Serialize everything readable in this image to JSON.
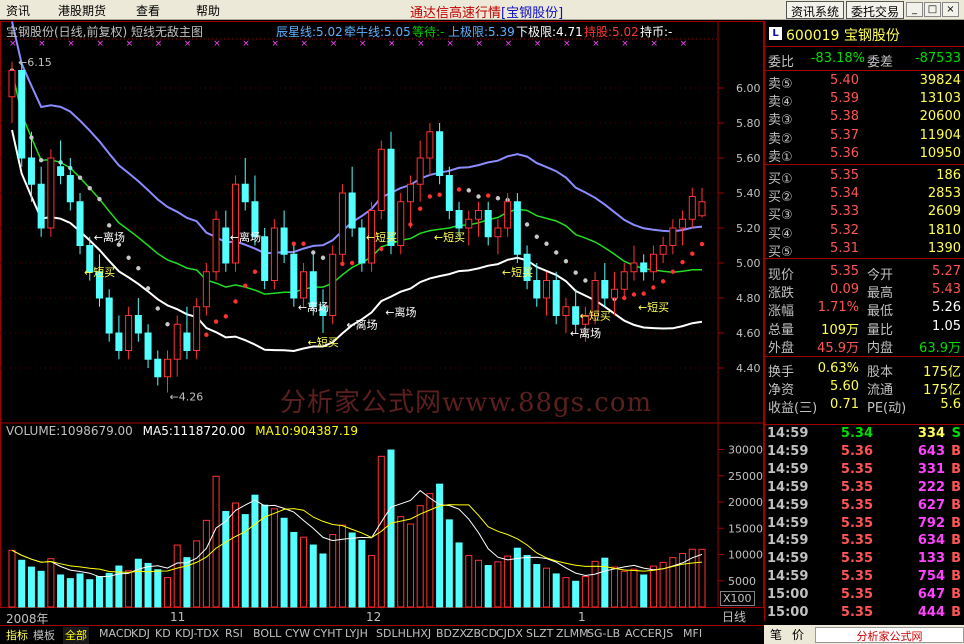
{
  "menu": [
    {
      "label": "资讯"
    },
    {
      "label": "港股期货"
    },
    {
      "label": "查看"
    },
    {
      "label": "帮助"
    }
  ],
  "app_title": "通达信高速行情",
  "app_stock": "[宝钢股份]",
  "toolbar": {
    "info_sys": "资讯系统",
    "trade": "委托交易"
  },
  "window_buttons": {
    "minimize": "_",
    "maximize": "□",
    "close": "×"
  },
  "chart_header": {
    "title": "宝钢股份(日线,前复权) 短线无敌主图",
    "items": [
      {
        "text": "辰星线:5.02",
        "color": "#5fafff"
      },
      {
        "text": "牵牛线:5.05",
        "color": "#5fafff"
      },
      {
        "text": "等待:-",
        "color": "#00cc00"
      },
      {
        "text": "上极限:5.39",
        "color": "#5fafff"
      },
      {
        "text": "下极限:4.71",
        "color": "#ffffff"
      },
      {
        "text": "持股:5.02",
        "color": "#ff3333"
      },
      {
        "text": "持币:-",
        "color": "#ffffff"
      }
    ]
  },
  "price_axis": [
    "6.00",
    "5.80",
    "5.60",
    "5.40",
    "5.20",
    "5.00",
    "4.80",
    "4.60",
    "4.40"
  ],
  "price_labels": {
    "high": "6.15",
    "low": "4.26"
  },
  "annotations": [
    "离场",
    "短买",
    "离场",
    "离场",
    "短买",
    "离场",
    "短买",
    "离场",
    "短买",
    "短买",
    "离场",
    "短买",
    "短买"
  ],
  "volume_header": {
    "volume": "VOLUME:1098679.00",
    "ma5": "MA5:1118720.00",
    "ma10": "MA10:904387.19"
  },
  "volume_axis": [
    "30000",
    "25000",
    "20000",
    "15000",
    "10000",
    "5000"
  ],
  "volume_unit": "X100",
  "x_axis": [
    "2008年",
    "11",
    "12",
    "1"
  ],
  "period_label": "日线",
  "watermark": "分析家公式网www.88gs.com",
  "quote": {
    "code": "600019",
    "name": "宝钢股份",
    "badge": "L",
    "weibi_label": "委比",
    "weibi": "-83.18%",
    "weicha_label": "委差",
    "weicha": "-87533",
    "asks": [
      {
        "label": "卖⑤",
        "price": "5.40",
        "vol": "39824"
      },
      {
        "label": "卖④",
        "price": "5.39",
        "vol": "13103"
      },
      {
        "label": "卖③",
        "price": "5.38",
        "vol": "20600"
      },
      {
        "label": "卖②",
        "price": "5.37",
        "vol": "11904"
      },
      {
        "label": "卖①",
        "price": "5.36",
        "vol": "10950"
      }
    ],
    "bids": [
      {
        "label": "买①",
        "price": "5.35",
        "vol": "186"
      },
      {
        "label": "买②",
        "price": "5.34",
        "vol": "2853"
      },
      {
        "label": "买③",
        "price": "5.33",
        "vol": "2609"
      },
      {
        "label": "买④",
        "price": "5.32",
        "vol": "1810"
      },
      {
        "label": "买⑤",
        "price": "5.31",
        "vol": "1390"
      }
    ],
    "stats": [
      {
        "l1": "现价",
        "v1": "5.35",
        "c1": "#ff5555",
        "l2": "今开",
        "v2": "5.27",
        "c2": "#ff5555"
      },
      {
        "l1": "涨跌",
        "v1": "0.09",
        "c1": "#ff5555",
        "l2": "最高",
        "v2": "5.43",
        "c2": "#ff5555"
      },
      {
        "l1": "涨幅",
        "v1": "1.71%",
        "c1": "#ff5555",
        "l2": "最低",
        "v2": "5.26",
        "c2": "#ffffff"
      },
      {
        "l1": "总量",
        "v1": "109万",
        "c1": "#ffff54",
        "l2": "量比",
        "v2": "1.05",
        "c2": "#ffffff"
      },
      {
        "l1": "外盘",
        "v1": "45.9万",
        "c1": "#ff5555",
        "l2": "内盘",
        "v2": "63.9万",
        "c2": "#00dd00"
      }
    ],
    "stats2": [
      {
        "l1": "换手",
        "v1": "0.63%",
        "l2": "股本",
        "v2": "175亿"
      },
      {
        "l1": "净资",
        "v1": "5.60",
        "l2": "流通",
        "v2": "175亿"
      },
      {
        "l1": "收益(三)",
        "v1": "0.71",
        "l2": "PE(动)",
        "v2": "5.6"
      }
    ]
  },
  "ticks": [
    {
      "time": "14:59",
      "price": "5.34",
      "vol": "334",
      "side": "S"
    },
    {
      "time": "14:59",
      "price": "5.36",
      "vol": "643",
      "side": "B"
    },
    {
      "time": "14:59",
      "price": "5.35",
      "vol": "331",
      "side": "B"
    },
    {
      "time": "14:59",
      "price": "5.35",
      "vol": "222",
      "side": "B"
    },
    {
      "time": "14:59",
      "price": "5.35",
      "vol": "627",
      "side": "B"
    },
    {
      "time": "14:59",
      "price": "5.35",
      "vol": "792",
      "side": "B"
    },
    {
      "time": "14:59",
      "price": "5.35",
      "vol": "634",
      "side": "B"
    },
    {
      "time": "14:59",
      "price": "5.35",
      "vol": "133",
      "side": "B"
    },
    {
      "time": "14:59",
      "price": "5.35",
      "vol": "754",
      "side": "B"
    },
    {
      "time": "15:00",
      "price": "5.35",
      "vol": "647",
      "side": "B"
    },
    {
      "time": "15:00",
      "price": "5.35",
      "vol": "444",
      "side": "B"
    }
  ],
  "bottom_tabs": [
    "指标",
    "模板",
    "全部",
    "MACD",
    "KDJ",
    "KD",
    "KDJ-TDX",
    "RSI",
    "BOLL",
    "CYW",
    "CYHT",
    "LYJH",
    "SDLH",
    "LHXJ",
    "BDZX",
    "ZBCD",
    "CJDX",
    "SLZT",
    "ZLMM",
    "SG-LB",
    "ACCER",
    "JS",
    "MFI"
  ],
  "right_tabs": [
    "笔",
    "价"
  ],
  "footer_brand": "分析家公式网 www.88gs.com",
  "colors": {
    "up": "#ff3232",
    "down": "#54ffff",
    "border": "#a00000",
    "upper_band": "#8c8cff",
    "lower_band": "#ffffff",
    "ma_green": "#22dd22",
    "ma5_vol": "#ffffff",
    "ma10_vol": "#ffff00"
  },
  "chart_data": {
    "type": "candlestick",
    "price_range": [
      4.2,
      6.2
    ],
    "volume_range": [
      0,
      32000
    ],
    "candles": [
      [
        5.95,
        6.15,
        5.8,
        6.1,
        10800
      ],
      [
        6.1,
        6.15,
        5.55,
        5.6,
        8900
      ],
      [
        5.6,
        5.75,
        5.35,
        5.45,
        7600
      ],
      [
        5.45,
        5.55,
        5.15,
        5.2,
        6800
      ],
      [
        5.2,
        5.65,
        5.15,
        5.6,
        9200
      ],
      [
        5.55,
        5.7,
        5.45,
        5.5,
        6100
      ],
      [
        5.5,
        5.6,
        5.3,
        5.35,
        5400
      ],
      [
        5.35,
        5.4,
        5.05,
        5.1,
        6300
      ],
      [
        5.1,
        5.15,
        4.9,
        4.95,
        5200
      ],
      [
        4.95,
        5.05,
        4.75,
        4.8,
        5800
      ],
      [
        4.8,
        4.85,
        4.55,
        4.6,
        6400
      ],
      [
        4.6,
        4.7,
        4.45,
        4.5,
        7800
      ],
      [
        4.5,
        4.75,
        4.45,
        4.7,
        6900
      ],
      [
        4.7,
        4.8,
        4.55,
        4.6,
        9100
      ],
      [
        4.6,
        4.65,
        4.4,
        4.45,
        8300
      ],
      [
        4.45,
        4.5,
        4.3,
        4.35,
        7100
      ],
      [
        4.35,
        4.5,
        4.26,
        4.45,
        5600
      ],
      [
        4.45,
        4.7,
        4.35,
        4.65,
        11800
      ],
      [
        4.6,
        4.75,
        4.45,
        4.5,
        9400
      ],
      [
        4.5,
        4.8,
        4.45,
        4.75,
        12600
      ],
      [
        4.75,
        5.0,
        4.7,
        4.95,
        16500
      ],
      [
        4.95,
        5.3,
        4.9,
        5.25,
        24900
      ],
      [
        5.2,
        5.3,
        4.95,
        5.0,
        18200
      ],
      [
        5.0,
        5.5,
        4.95,
        5.45,
        19800
      ],
      [
        5.45,
        5.6,
        5.3,
        5.35,
        17600
      ],
      [
        5.35,
        5.5,
        5.1,
        5.15,
        21300
      ],
      [
        5.15,
        5.2,
        4.85,
        4.9,
        19400
      ],
      [
        4.9,
        5.25,
        4.85,
        5.2,
        18700
      ],
      [
        5.2,
        5.3,
        5.0,
        5.05,
        16900
      ],
      [
        5.05,
        5.1,
        4.75,
        4.8,
        14200
      ],
      [
        4.8,
        5.0,
        4.75,
        4.95,
        13300
      ],
      [
        4.95,
        5.05,
        4.7,
        4.75,
        11800
      ],
      [
        4.75,
        4.85,
        4.6,
        4.7,
        10100
      ],
      [
        4.7,
        5.1,
        4.65,
        5.05,
        13800
      ],
      [
        5.05,
        5.45,
        5.0,
        5.4,
        15600
      ],
      [
        5.4,
        5.55,
        5.15,
        5.2,
        14100
      ],
      [
        5.2,
        5.25,
        4.95,
        5.0,
        12700
      ],
      [
        5.0,
        5.35,
        4.95,
        5.3,
        9800
      ],
      [
        5.3,
        5.7,
        5.25,
        5.65,
        28700
      ],
      [
        5.65,
        5.75,
        5.05,
        5.1,
        29900
      ],
      [
        5.1,
        5.4,
        5.05,
        5.35,
        17200
      ],
      [
        5.35,
        5.5,
        5.2,
        5.45,
        15800
      ],
      [
        5.45,
        5.7,
        5.35,
        5.6,
        19300
      ],
      [
        5.6,
        5.8,
        5.5,
        5.75,
        21600
      ],
      [
        5.75,
        5.8,
        5.45,
        5.5,
        23400
      ],
      [
        5.5,
        5.55,
        5.25,
        5.3,
        16600
      ],
      [
        5.3,
        5.35,
        5.15,
        5.2,
        12200
      ],
      [
        5.2,
        5.3,
        5.1,
        5.25,
        9800
      ],
      [
        5.25,
        5.35,
        5.15,
        5.3,
        8900
      ],
      [
        5.3,
        5.35,
        5.1,
        5.15,
        7900
      ],
      [
        5.15,
        5.25,
        5.05,
        5.2,
        8600
      ],
      [
        5.2,
        5.4,
        5.15,
        5.35,
        9700
      ],
      [
        5.35,
        5.4,
        5.0,
        5.05,
        11200
      ],
      [
        5.05,
        5.1,
        4.85,
        4.9,
        9800
      ],
      [
        4.9,
        5.0,
        4.75,
        4.8,
        8100
      ],
      [
        4.8,
        4.95,
        4.7,
        4.9,
        7400
      ],
      [
        4.9,
        4.95,
        4.65,
        4.7,
        6300
      ],
      [
        4.7,
        4.8,
        4.6,
        4.75,
        5600
      ],
      [
        4.75,
        4.85,
        4.6,
        4.65,
        4900
      ],
      [
        4.65,
        4.75,
        4.55,
        4.7,
        5800
      ],
      [
        4.7,
        4.95,
        4.65,
        4.9,
        8700
      ],
      [
        4.9,
        5.0,
        4.75,
        4.8,
        9300
      ],
      [
        4.8,
        4.95,
        4.7,
        4.85,
        7600
      ],
      [
        4.85,
        5.0,
        4.8,
        4.95,
        6800
      ],
      [
        4.95,
        5.1,
        4.9,
        5.0,
        7200
      ],
      [
        5.0,
        5.05,
        4.9,
        4.95,
        6100
      ],
      [
        4.95,
        5.1,
        4.9,
        5.05,
        7800
      ],
      [
        5.05,
        5.15,
        5.0,
        5.1,
        8500
      ],
      [
        5.1,
        5.25,
        5.05,
        5.2,
        9400
      ],
      [
        5.2,
        5.3,
        5.1,
        5.25,
        10200
      ],
      [
        5.25,
        5.43,
        5.2,
        5.38,
        11000
      ],
      [
        5.27,
        5.43,
        5.26,
        5.35,
        10986
      ]
    ]
  }
}
